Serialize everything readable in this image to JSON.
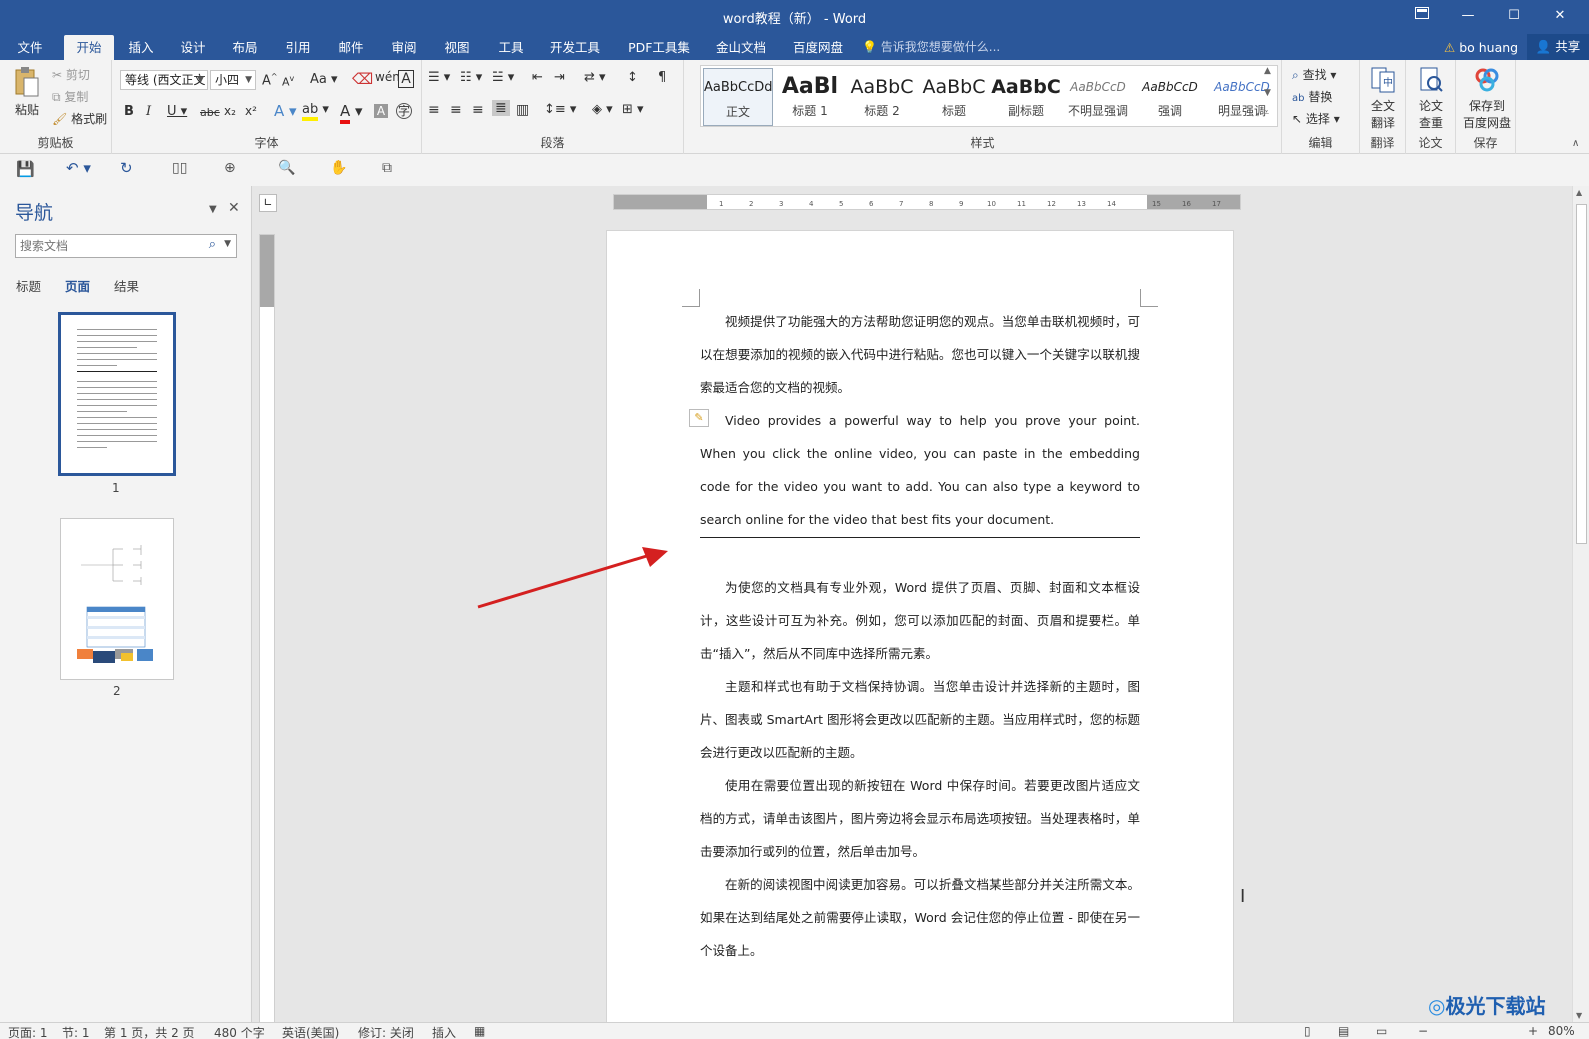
{
  "window": {
    "title": "word教程（新） - Word",
    "ribbon_display_icon": "ribbon-display-icon",
    "minimize": "—",
    "maximize": "☐",
    "close": "✕"
  },
  "menu": {
    "tabs": [
      "文件",
      "开始",
      "插入",
      "设计",
      "布局",
      "引用",
      "邮件",
      "审阅",
      "视图",
      "工具",
      "开发工具",
      "PDF工具集",
      "金山文档",
      "百度网盘"
    ],
    "active": "开始",
    "tell_me": "告诉我您想要做什么...",
    "user": "bo huang",
    "share": "共享"
  },
  "ribbon": {
    "clipboard": {
      "paste": "粘贴",
      "cut": "剪切",
      "copy": "复制",
      "format_painter": "格式刷",
      "label": "剪贴板"
    },
    "font": {
      "font_name": "等线 (西文正文",
      "font_size": "小四",
      "change_case": "Aa",
      "label": "字体"
    },
    "paragraph": {
      "label": "段落"
    },
    "styles": {
      "label": "样式",
      "items": [
        {
          "sample": "AaBbCcDd",
          "name": "正文"
        },
        {
          "sample": "AaBl",
          "name": "标题 1"
        },
        {
          "sample": "AaBbC",
          "name": "标题 2"
        },
        {
          "sample": "AaBbC",
          "name": "标题"
        },
        {
          "sample": "AaBbC",
          "name": "副标题"
        },
        {
          "sample": "AaBbCcD",
          "name": "不明显强调"
        },
        {
          "sample": "AaBbCcD",
          "name": "强调"
        },
        {
          "sample": "AaBbCcD",
          "name": "明显强调"
        }
      ]
    },
    "editing": {
      "find": "查找",
      "replace": "替换",
      "select": "选择",
      "label": "编辑"
    },
    "translate": {
      "full_translate_1": "全文",
      "full_translate_2": "翻译",
      "label": "翻译"
    },
    "paper": {
      "check_1": "论文",
      "check_2": "查重",
      "label": "论文"
    },
    "save": {
      "save_1": "保存到",
      "save_2": "百度网盘",
      "label": "保存"
    }
  },
  "nav": {
    "title": "导航",
    "search_placeholder": "搜索文档",
    "tabs": [
      "标题",
      "页面",
      "结果"
    ],
    "active_tab": "页面",
    "pages": [
      "1",
      "2"
    ]
  },
  "document": {
    "paragraphs": [
      "视频提供了功能强大的方法帮助您证明您的观点。当您单击联机视频时，可以在想要添加的视频的嵌入代码中进行粘贴。您也可以键入一个关键字以联机搜索最适合您的文档的视频。",
      "Video provides a powerful way to help you prove your point. When you click the online video, you can paste in the embedding code for the video you want to add. You can also type a keyword to search online for the video that best fits your document.",
      "为使您的文档具有专业外观，Word 提供了页眉、页脚、封面和文本框设计，这些设计可互为补充。例如，您可以添加匹配的封面、页眉和提要栏。单击“插入”，然后从不同库中选择所需元素。",
      "主题和样式也有助于文档保持协调。当您单击设计并选择新的主题时，图片、图表或 SmartArt 图形将会更改以匹配新的主题。当应用样式时，您的标题会进行更改以匹配新的主题。",
      "使用在需要位置出现的新按钮在 Word 中保存时间。若要更改图片适应文档的方式，请单击该图片，图片旁边将会显示布局选项按钮。当处理表格时，单击要添加行或列的位置，然后单击加号。",
      "在新的阅读视图中阅读更加容易。可以折叠文档某些部分并关注所需文本。如果在达到结尾处之前需要停止读取，Word 会记住您的停止位置 - 即使在另一个设备上。"
    ]
  },
  "status": {
    "page": "页面: 1",
    "section": "节: 1",
    "page_of": "第 1 页，共 2 页",
    "words": "480 个字",
    "language": "英语(美国)",
    "track": "修订: 关闭",
    "insert": "插入",
    "zoom": "80%"
  },
  "watermark": {
    "text": "极光下载站"
  },
  "colors": {
    "accent": "#2b579a",
    "arrow": "#d42020"
  }
}
